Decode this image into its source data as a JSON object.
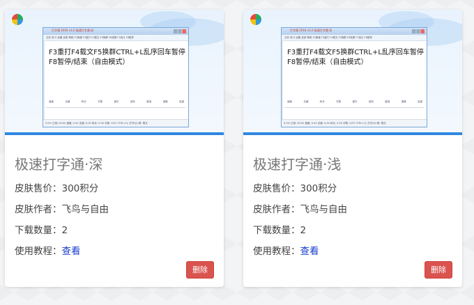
{
  "colors": {
    "accent_blue": "#2f87e0",
    "delete_red": "#d9534f",
    "link_blue": "#1a3fd0"
  },
  "cards": [
    {
      "preview": {
        "window_title": "打字通 2016 v3.2  极速打字通·深",
        "menu": "文件  练习  设置  皮肤  帮助  F2换课  F3重打  F4载文  F5换群  F6滚屏  F7统计  F8暂停",
        "practice_text": "F3重打F4载文F5换群CTRL+L乱序回车暂停F8暂停/结束（自由模式）",
        "keys": [
          "速度",
          "击键",
          "码长",
          "字数",
          "错字",
          "回改",
          "键准",
          "退格",
          "选重"
        ],
        "status": "0.0% 已用: 00:00  速度: 0.00  击键: 0.00  码长: 0.00  字数: 0/37  CTRL+Q: 打开QQ  群: 载文"
      },
      "name": "极速打字通·深",
      "price_label": "皮肤售价：",
      "price_value": "300积分",
      "author_label": "皮肤作者：",
      "author_value": "飞鸟与自由",
      "downloads_label": "下载数量：",
      "downloads_value": "2",
      "tutorial_label": "使用教程：",
      "tutorial_link": "查看",
      "delete_label": "删除"
    },
    {
      "preview": {
        "window_title": "打字通 2016 v3.2  极速打字通·浅",
        "menu": "文件  练习  设置  皮肤  帮助  F2换课  F3重打  F4载文  F5换群  F6滚屏  F7统计  F8暂停",
        "practice_text": "F3重打F4载文F5换群CTRL+L乱序回车暂停F8暂停/结束（自由模式）",
        "keys": [
          "速度",
          "击键",
          "码长",
          "字数",
          "错字",
          "回改",
          "键准",
          "退格",
          "选重"
        ],
        "status": "0.0% 已用: 00:00  速度: 0.00  击键: 0.00  码长: 0.00  字数: 0/37  CTRL+Q: 打开QQ  群: 载文"
      },
      "name": "极速打字通·浅",
      "price_label": "皮肤售价：",
      "price_value": "300积分",
      "author_label": "皮肤作者：",
      "author_value": "飞鸟与自由",
      "downloads_label": "下载数量：",
      "downloads_value": "2",
      "tutorial_label": "使用教程：",
      "tutorial_link": "查看",
      "delete_label": "删除"
    }
  ]
}
